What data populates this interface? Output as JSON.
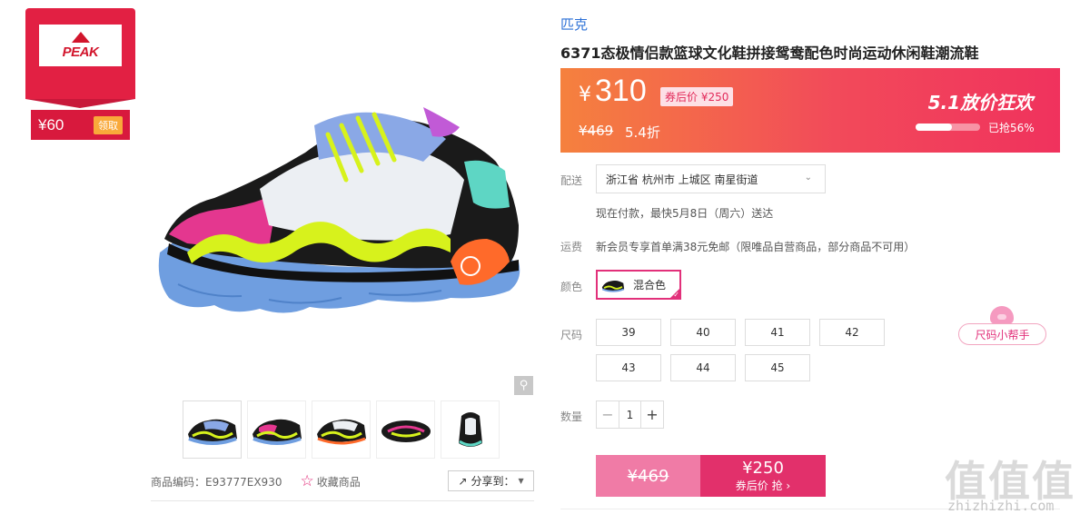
{
  "coupon": {
    "brand_logo": "PEAK",
    "amount": "¥60",
    "claim_label": "领取",
    "colors": {
      "primary": "#e22043",
      "claim_bg": "#f9a93a"
    }
  },
  "gallery": {
    "main_image": "sneaker-side-view",
    "thumbnails": [
      "sneaker-side-1",
      "sneaker-side-2",
      "sneaker-side-3",
      "sneaker-top",
      "sneaker-heel"
    ],
    "zoom_icon": "magnifier-icon"
  },
  "meta": {
    "sku_code": "商品编码：E93777EX930",
    "favorite_label": "收藏商品",
    "share_label": "分享到："
  },
  "product": {
    "brand": "匹克",
    "title": "6371态极情侣款篮球文化鞋拼接鸳鸯配色时尚运动休闲鞋潮流鞋"
  },
  "price": {
    "yen": "¥",
    "current": "310",
    "after_coupon": "券后价 ¥250",
    "original": "¥469",
    "discount": "5.4折",
    "promo": "5.1放价狂欢",
    "sold_ratio": 0.56,
    "sold_text": "已抢56%"
  },
  "delivery": {
    "label": "配送",
    "address": "浙江省 杭州市 上城区 南星街道",
    "eta": "现在付款，最快5月8日（周六）送达"
  },
  "shipping": {
    "label": "运费",
    "text": "新会员专享首单满38元免邮（限唯品自营商品，部分商品不可用）"
  },
  "color": {
    "label": "颜色",
    "selected": "混合色"
  },
  "size": {
    "label": "尺码",
    "options": [
      "39",
      "40",
      "41",
      "42",
      "43",
      "44",
      "45"
    ],
    "helper": "尺码小帮手"
  },
  "quantity": {
    "label": "数量",
    "value": "1"
  },
  "buy": {
    "original_price": "¥469",
    "coupon_price": "¥250",
    "coupon_cta": "券后价 抢 ›"
  },
  "watermark": {
    "main": "值值值",
    "sub": "zhizhizhi.com"
  }
}
